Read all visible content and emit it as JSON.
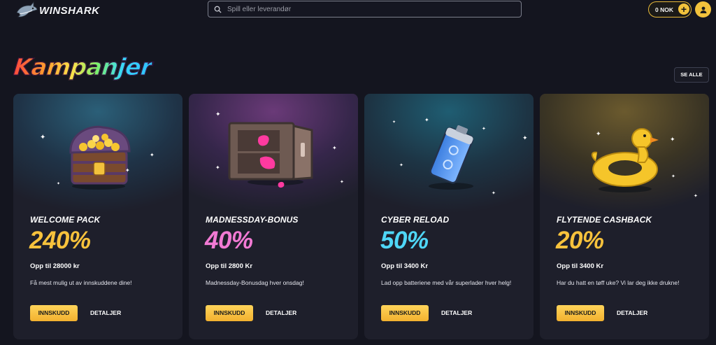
{
  "header": {
    "logo_text": "WINSHARK",
    "search_placeholder": "Spill eller leverandør",
    "balance": "0 NOK"
  },
  "section": {
    "title": "Kampanjer",
    "see_all": "SE ALLE"
  },
  "cards": [
    {
      "title": "WELCOME PACK",
      "percent": "240%",
      "percent_color": "#f7c23c",
      "subtitle": "Opp til 28000 kr",
      "description": "Få mest mulig ut av innskuddene dine!",
      "deposit_label": "INNSKUDD",
      "details_label": "DETALJER",
      "icon": "treasure-chest-icon"
    },
    {
      "title": "MADNESSDAY-BONUS",
      "percent": "40%",
      "percent_color": "#f27ad4",
      "subtitle": "Opp til 2800 Kr",
      "description": "Madnessday-Bonusdag hver onsdag!",
      "deposit_label": "INNSKUDD",
      "details_label": "DETALJER",
      "icon": "vault-safe-icon"
    },
    {
      "title": "CYBER RELOAD",
      "percent": "50%",
      "percent_color": "#4fd7f7",
      "subtitle": "Opp til 3400 Kr",
      "description": "Lad opp batteriene med vår superlader hver helg!",
      "deposit_label": "INNSKUDD",
      "details_label": "DETALJER",
      "icon": "battery-icon"
    },
    {
      "title": "FLYTENDE CASHBACK",
      "percent": "20%",
      "percent_color": "#f7c23c",
      "subtitle": "Opp til 3400 Kr",
      "description": "Har du hatt en tøff uke? Vi lar deg ikke drukne!",
      "deposit_label": "INNSKUDD",
      "details_label": "DETALJER",
      "icon": "duck-float-icon"
    }
  ]
}
